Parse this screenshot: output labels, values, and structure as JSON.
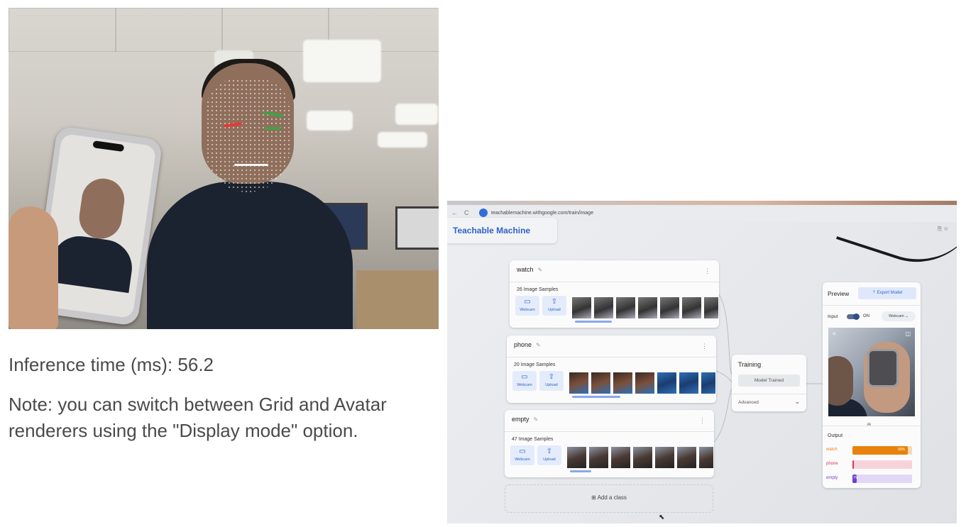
{
  "left_panel": {
    "inference_label": "Inference time (ms):",
    "inference_value": "56.2",
    "note": "Note: you can switch between Grid and Avatar renderers using the \"Display mode\" option."
  },
  "browser": {
    "url": "teachablemachine.withgoogle.com/train/image"
  },
  "app": {
    "logo": "Teachable Machine"
  },
  "classes": [
    {
      "name": "watch",
      "samples": "26 Image Samples"
    },
    {
      "name": "phone",
      "samples": "20 Image Samples"
    },
    {
      "name": "empty",
      "samples": "47 Image Samples"
    }
  ],
  "tools": {
    "webcam": "Webcam",
    "upload": "Upload"
  },
  "training": {
    "title": "Training",
    "status_button": "Model Trained",
    "advanced": "Advanced"
  },
  "add_class": "Add a class",
  "preview": {
    "title": "Preview",
    "export": "Export Model",
    "input_label": "Input",
    "input_state": "ON",
    "source": "Webcam",
    "output_label": "Output",
    "outputs": [
      {
        "name": "watch",
        "percent": 93,
        "label": "93%",
        "color": "#e8820c",
        "track": "#f7d9b6"
      },
      {
        "name": "phone",
        "percent": 2,
        "label": "",
        "color": "#d8355a",
        "track": "#f6d3db"
      },
      {
        "name": "empty",
        "percent": 7,
        "label": "7%",
        "color": "#6a3fd6",
        "track": "#e1d8f6"
      }
    ]
  },
  "icons": {
    "webcam": "video-camera-icon",
    "upload": "upload-icon",
    "edit": "pencil-icon",
    "menu": "kebab-menu-icon",
    "add": "add-box-icon",
    "chevron": "chevron-down-icon",
    "export": "export-icon"
  }
}
